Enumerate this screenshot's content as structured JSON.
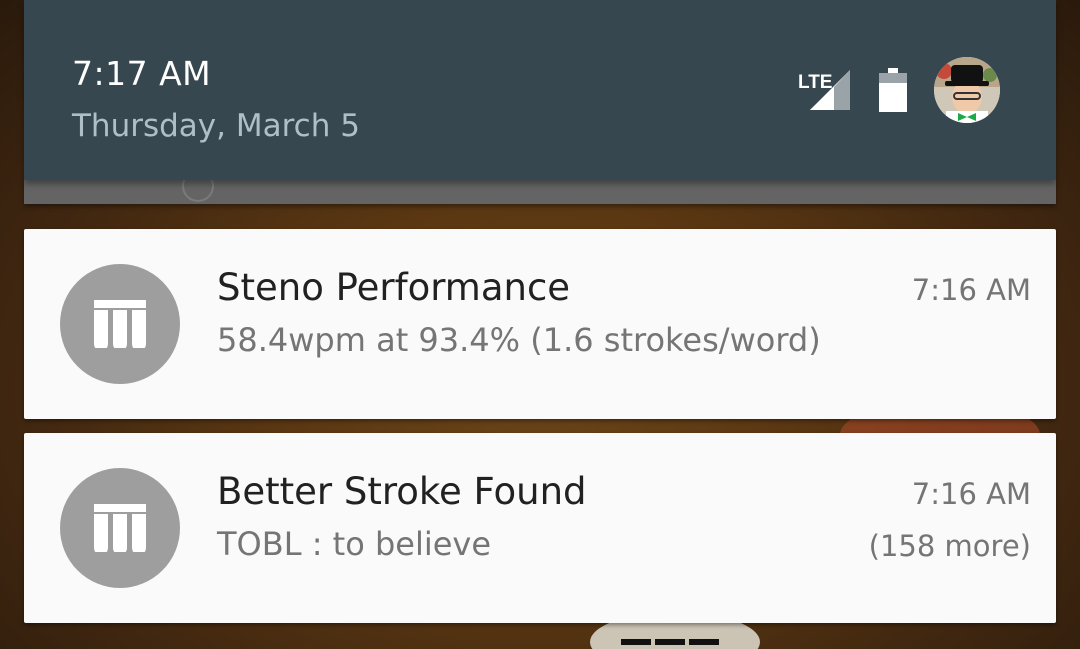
{
  "header": {
    "time": "7:17 AM",
    "date": "Thursday, March 5",
    "network_label": "LTE",
    "icons": [
      "lte-signal-icon",
      "battery-icon",
      "user-avatar"
    ]
  },
  "notifications": [
    {
      "icon": "steno-keyboard-icon",
      "title": "Steno Performance",
      "text": "58.4wpm at 93.4% (1.6 strokes/word)",
      "time": "7:16 AM"
    },
    {
      "icon": "steno-keyboard-icon",
      "title": "Better Stroke Found",
      "text": "TOBL : to believe",
      "time": "7:16 AM",
      "more": "(158 more)"
    }
  ],
  "colors": {
    "header_bg": "#37474f",
    "card_bg": "#fafafa",
    "icon_bg": "#9e9e9e",
    "title_text": "#212121",
    "secondary_text": "#757575"
  }
}
